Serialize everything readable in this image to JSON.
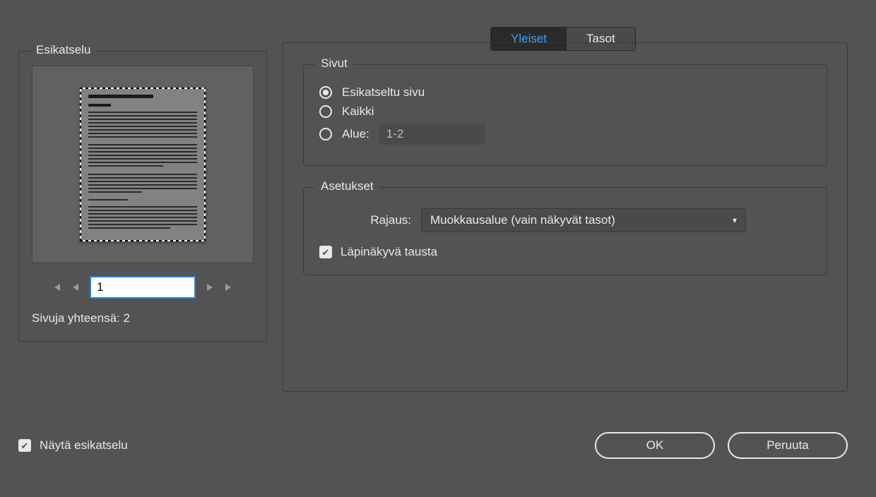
{
  "tabs": {
    "general": "Yleiset",
    "layers": "Tasot"
  },
  "preview": {
    "title": "Esikatselu",
    "page_value": "1",
    "total_label": "Sivuja yhteensä: 2"
  },
  "pages_group": {
    "title": "Sivut",
    "opt_previewed": "Esikatseltu sivu",
    "opt_all": "Kaikki",
    "opt_range": "Alue:",
    "range_value": "1-2"
  },
  "settings_group": {
    "title": "Asetukset",
    "crop_label": "Rajaus:",
    "crop_value": "Muokkausalue (vain näkyvät tasot)",
    "transparent_bg": "Läpinäkyvä tausta"
  },
  "footer": {
    "show_preview": "Näytä esikatselu",
    "ok": "OK",
    "cancel": "Peruuta"
  }
}
